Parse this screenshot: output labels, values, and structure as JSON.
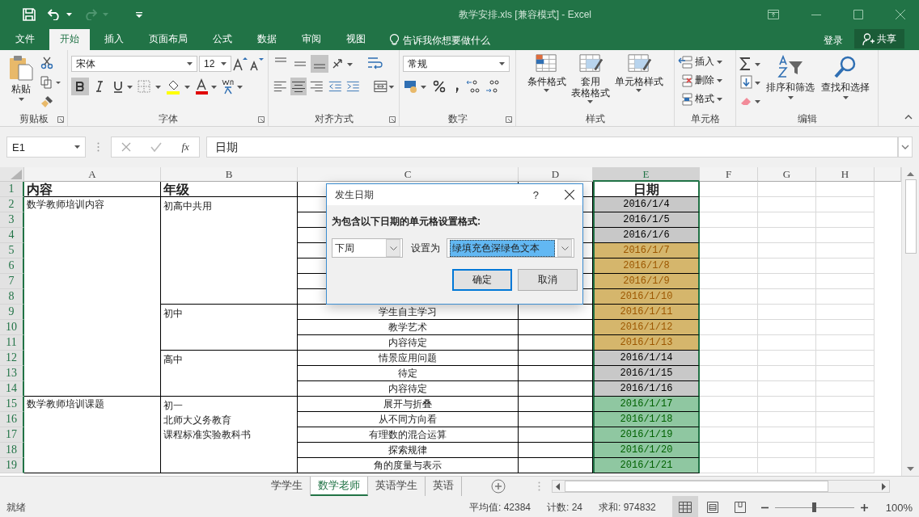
{
  "title_bar": {
    "title": "教学安排.xls  [兼容模式] - Excel",
    "redo_disabled": true
  },
  "menu_tabs": [
    {
      "label": "文件",
      "selected": false
    },
    {
      "label": "开始",
      "selected": true
    },
    {
      "label": "插入",
      "selected": false
    },
    {
      "label": "页面布局",
      "selected": false
    },
    {
      "label": "公式",
      "selected": false
    },
    {
      "label": "数据",
      "selected": false
    },
    {
      "label": "审阅",
      "selected": false
    },
    {
      "label": "视图",
      "selected": false
    }
  ],
  "tell_me": "告诉我你想要做什么",
  "sign_in": "登录",
  "share": "共享",
  "ribbon": {
    "clipboard": {
      "label": "剪贴板",
      "paste": "粘贴"
    },
    "font": {
      "label": "字体",
      "font_name": "宋体",
      "font_size": "12",
      "bold": true
    },
    "alignment": {
      "label": "对齐方式",
      "bottom": true,
      "center": true
    },
    "number": {
      "label": "数字",
      "format": "常规"
    },
    "styles": {
      "label": "样式",
      "buttons": [
        {
          "lines": [
            "条件格式"
          ]
        },
        {
          "lines": [
            "套用",
            "表格格式"
          ]
        },
        {
          "lines": [
            "单元格样式"
          ]
        }
      ]
    },
    "cells": {
      "label": "单元格",
      "buttons": [
        "插入",
        "删除",
        "格式"
      ]
    },
    "editing": {
      "label": "编辑",
      "buttons": [
        "排序和筛选",
        "查找和选择"
      ]
    }
  },
  "formula_bar": {
    "name_box": "E1",
    "function_label": "fx",
    "value": "日期"
  },
  "sheet": {
    "rows_highlighted": true,
    "columns": [
      {
        "label": "A",
        "selected": false
      },
      {
        "label": "B",
        "selected": false
      },
      {
        "label": "C",
        "selected": false
      },
      {
        "label": "D",
        "selected": false
      },
      {
        "label": "E",
        "selected": true
      },
      {
        "label": "F",
        "selected": false
      },
      {
        "label": "G",
        "selected": false
      },
      {
        "label": "H",
        "selected": false
      }
    ],
    "header": {
      "row": "1",
      "a": "内容",
      "b": "年级",
      "e": "日期"
    },
    "sections": [
      {
        "content": "数学教师培训内容",
        "grades": [
          {
            "grade": [
              "初高中共用"
            ],
            "items": [
              {
                "row": "2",
                "date": "2016/1/4",
                "kind": "neutral"
              },
              {
                "row": "3",
                "date": "2016/1/5",
                "kind": "neutral"
              },
              {
                "row": "4",
                "date": "2016/1/6",
                "kind": "neutral"
              },
              {
                "row": "5",
                "date": "2016/1/7",
                "kind": "warning"
              },
              {
                "row": "6",
                "date": "2016/1/8",
                "kind": "warning"
              },
              {
                "row": "7",
                "date": "2016/1/9",
                "kind": "warning"
              },
              {
                "row": "8",
                "date": "2016/1/10",
                "kind": "warning"
              }
            ]
          },
          {
            "grade": [
              "初中"
            ],
            "items": [
              {
                "row": "9",
                "topic": "学生自主学习",
                "date": "2016/1/11",
                "kind": "warning"
              },
              {
                "row": "10",
                "topic": "教学艺术",
                "date": "2016/1/12",
                "kind": "warning"
              },
              {
                "row": "11",
                "topic": "内容待定",
                "date": "2016/1/13",
                "kind": "warning"
              }
            ]
          },
          {
            "grade": [
              "高中"
            ],
            "items": [
              {
                "row": "12",
                "topic": "情景应用问题",
                "date": "2016/1/14",
                "kind": "neutral"
              },
              {
                "row": "13",
                "topic": "待定",
                "date": "2016/1/15",
                "kind": "neutral"
              },
              {
                "row": "14",
                "topic": "内容待定",
                "date": "2016/1/16",
                "kind": "neutral"
              }
            ]
          }
        ]
      },
      {
        "content": "数学教师培训课题",
        "grades": [
          {
            "grade": [
              "初一",
              "北师大义务教育",
              "课程标准实验教科书"
            ],
            "items": [
              {
                "row": "15",
                "topic": "展开与折叠",
                "date": "2016/1/17",
                "kind": "good"
              },
              {
                "row": "16",
                "topic": "从不同方向看",
                "date": "2016/1/18",
                "kind": "good"
              },
              {
                "row": "17",
                "topic": "有理数的混合运算",
                "date": "2016/1/19",
                "kind": "good"
              },
              {
                "row": "18",
                "topic": "探索规律",
                "date": "2016/1/20",
                "kind": "good"
              },
              {
                "row": "19",
                "topic": "角的度量与表示",
                "date": "2016/1/21",
                "kind": "good"
              }
            ]
          }
        ]
      }
    ]
  },
  "dialog": {
    "title": "发生日期",
    "help": "?",
    "prompt": "为包含以下日期的单元格设置格式:",
    "period": "下周",
    "set_as_label": "设置为",
    "format": "绿填充色深绿色文本",
    "ok": "确定",
    "cancel": "取消"
  },
  "sheet_tabs": [
    {
      "label": "学学生",
      "selected": false
    },
    {
      "label": "数学老师",
      "selected": true
    },
    {
      "label": "英语学生",
      "selected": false
    },
    {
      "label": "英语",
      "selected": false
    }
  ],
  "status_bar": {
    "status": "就绪",
    "average": "平均值: 42384",
    "count": "计数: 24",
    "sum": "求和: 974832",
    "views": [
      {
        "kind": "normal",
        "selected": true
      },
      {
        "kind": "page_layout",
        "selected": false
      },
      {
        "kind": "page_break",
        "selected": false
      }
    ],
    "zoom": {
      "level": 0.5,
      "label": "100%"
    }
  }
}
